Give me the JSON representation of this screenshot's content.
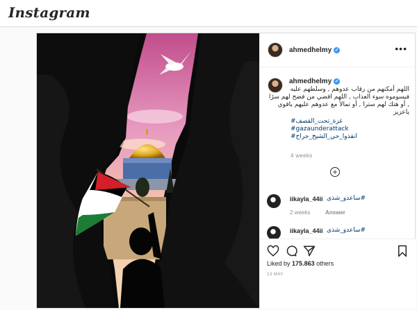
{
  "app": {
    "logo_text": "Instagram"
  },
  "post": {
    "username": "ahmedhelmy",
    "verified": true,
    "more_icon": "ellipsis-icon",
    "caption": "اللهم أمكنهم من رقاب عدوهم , وسلطهم عليه فيسوموه سوء العذاب , اللهم اقضي من فضح لهم سرًا , أو هتك لهم سترا , أو تمالأ مع عدوهم عليهم ياقوي ياعزيز",
    "hashtags": [
      "غزة_تحت_القصف#",
      "#gazaunderattack",
      "انقذوا_حي_الشيخ_جراح#"
    ],
    "time_ago": "4 weeks",
    "load_more_icon": "plus-circle-icon",
    "comments": [
      {
        "username": "iikayla_44ii",
        "text": "ساعدو_شذى#",
        "time": "2 weeks",
        "reply_label": "Answer"
      },
      {
        "username": "iikayla_44ii",
        "text": "ساعدو_شذى#",
        "time": "",
        "reply_label": ""
      }
    ],
    "likes_prefix": "Liked by",
    "likes_count": "175.863",
    "likes_suffix": "others",
    "date": "13 MAY"
  },
  "colors": {
    "accent_link": "#00376b",
    "verified_blue": "#3897f0",
    "border": "#dbdbdb"
  }
}
